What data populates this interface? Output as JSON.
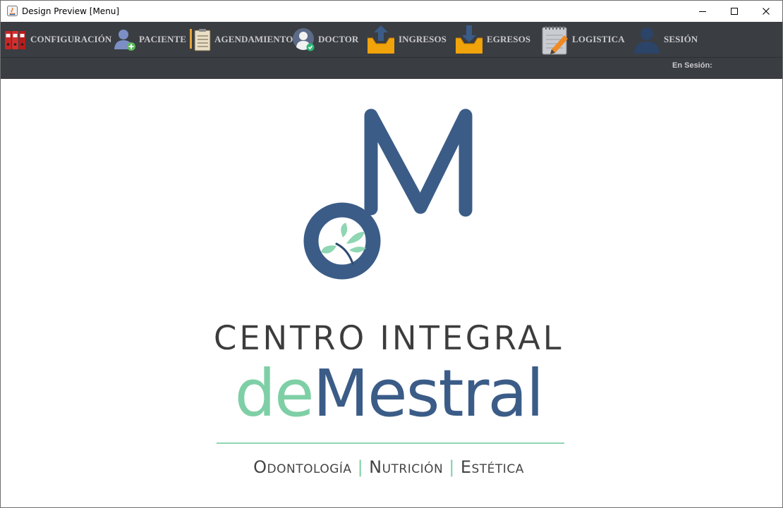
{
  "window": {
    "title": "Design Preview [Menu]"
  },
  "menu": {
    "items": [
      {
        "label": "CONFIGURACIÓN",
        "icon": "binders-icon"
      },
      {
        "label": "PACIENTE",
        "icon": "add-patient-icon"
      },
      {
        "label": "AGENDAMIENTO",
        "icon": "clipboard-icon"
      },
      {
        "label": "DOCTOR",
        "icon": "doctor-icon"
      },
      {
        "label": "INGRESOS",
        "icon": "inbox-upload-icon"
      },
      {
        "label": "EGRESOS",
        "icon": "inbox-download-icon"
      },
      {
        "label": "LOGISTICA",
        "icon": "notepad-edit-icon"
      },
      {
        "label": "SESIÓN",
        "icon": "user-icon"
      }
    ]
  },
  "status": {
    "session_label": "En Sesión:"
  },
  "logo": {
    "line1": "CENTRO INTEGRAL",
    "de": "de",
    "mestral": "Mestral",
    "tagline": [
      "Odontología",
      "Nutrición",
      "Estética"
    ],
    "separator": "|",
    "colors": {
      "navy": "#3b5c87",
      "mint": "#7fcfa6",
      "dark": "#3c3c3c"
    }
  }
}
